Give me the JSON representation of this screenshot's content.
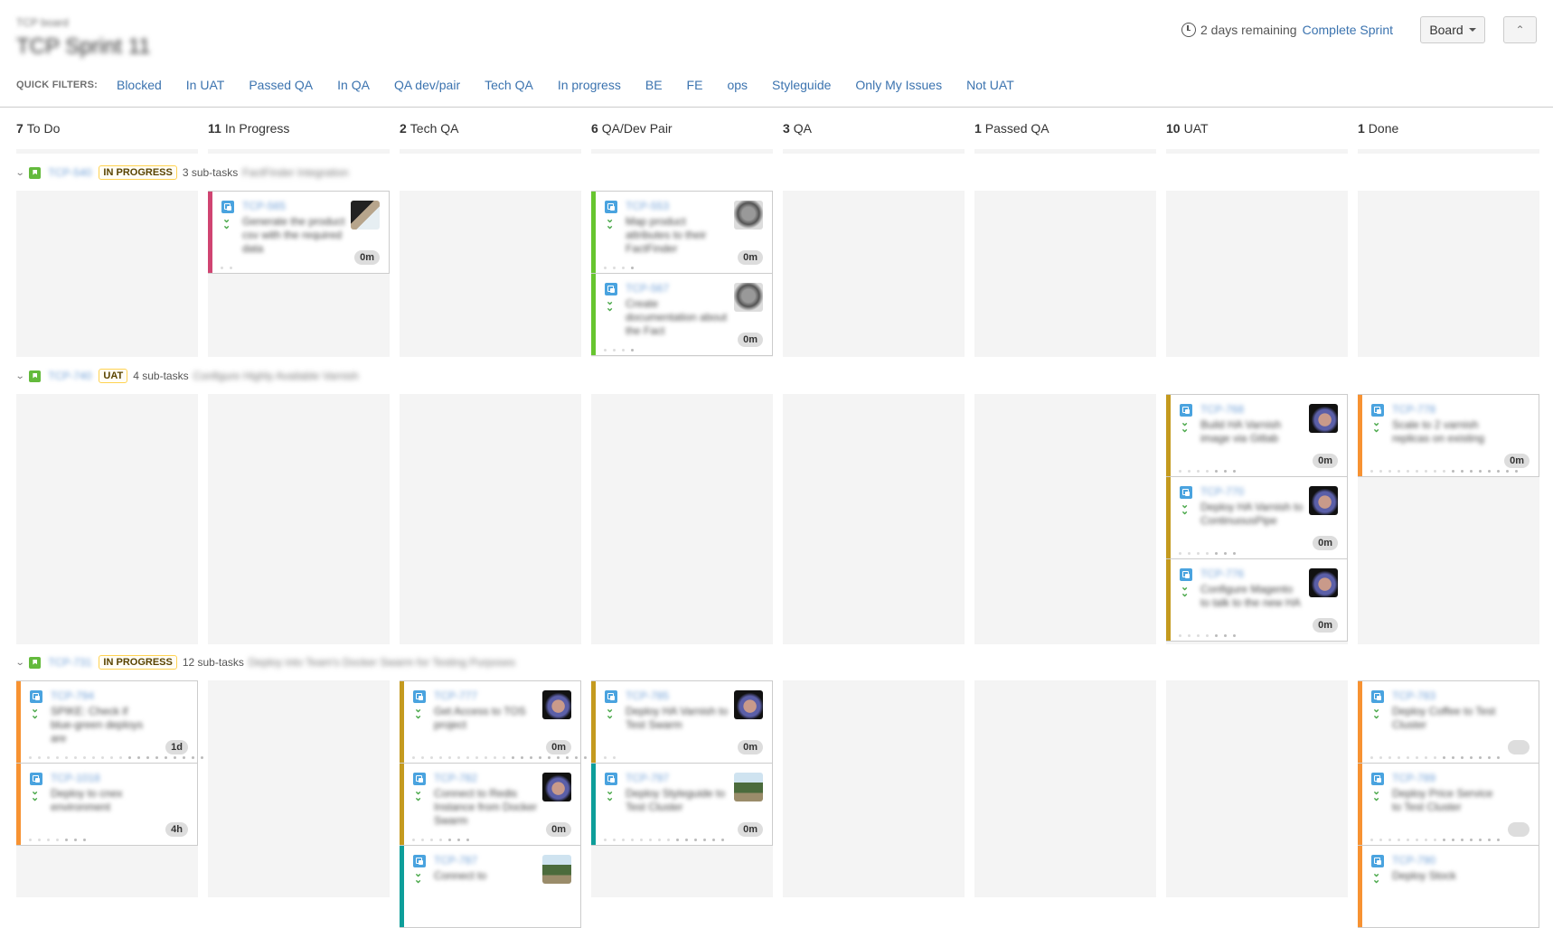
{
  "header": {
    "project_name": "TCP board",
    "sprint_name": "TCP Sprint 11",
    "time_remaining": "2 days remaining",
    "complete_sprint_label": "Complete Sprint",
    "board_button_label": "Board",
    "collapse_icon": "double-chevron-up-icon",
    "clock_icon": "clock-icon"
  },
  "quick_filters": {
    "label": "QUICK FILTERS:",
    "items": [
      "Blocked",
      "In UAT",
      "Passed QA",
      "In QA",
      "QA dev/pair",
      "Tech QA",
      "In progress",
      "BE",
      "FE",
      "ops",
      "Styleguide",
      "Only My Issues",
      "Not UAT"
    ]
  },
  "columns": [
    {
      "count": "7",
      "name": "To Do"
    },
    {
      "count": "11",
      "name": "In Progress"
    },
    {
      "count": "2",
      "name": "Tech QA"
    },
    {
      "count": "6",
      "name": "QA/Dev Pair"
    },
    {
      "count": "3",
      "name": "QA"
    },
    {
      "count": "1",
      "name": "Passed QA"
    },
    {
      "count": "10",
      "name": "UAT"
    },
    {
      "count": "1",
      "name": "Done"
    }
  ],
  "colors": {
    "link": "#3b73af",
    "story_green": "#63ba3c",
    "subtask_blue": "#4aa3df",
    "priority_green": "#4aa84a",
    "grab_pink": "#d04472",
    "grab_green": "#67c52f",
    "grab_gold": "#c49a1f",
    "grab_orange": "#f79232",
    "grab_teal": "#0d9e9a"
  },
  "swimlanes": [
    {
      "key": "TCP-540",
      "status": "IN PROGRESS",
      "subtasks": "3 sub-tasks",
      "summary": "FactFinder Integration",
      "cells": [
        [],
        [
          {
            "key": "TCP-565",
            "summary": "Generate the product csv with the required data",
            "estimate": "0m",
            "grab": "#d04472",
            "avatar": "av-c",
            "dots": 2
          }
        ],
        [],
        [
          {
            "key": "TCP-553",
            "summary": "Map product attributes to their FactFinder",
            "estimate": "0m",
            "grab": "#67c52f",
            "avatar": "av-b",
            "dots": 4
          },
          {
            "key": "TCP-567",
            "summary": "Create documentation about the Fact",
            "estimate": "0m",
            "grab": "#67c52f",
            "avatar": "av-b",
            "dots": 4
          }
        ],
        [],
        [],
        [],
        []
      ]
    },
    {
      "key": "TCP-740",
      "status": "UAT",
      "subtasks": "4 sub-tasks",
      "summary": "Configure Highly Available Varnish",
      "cells": [
        [],
        [],
        [],
        [],
        [],
        [],
        [
          {
            "key": "TCP-768",
            "summary": "Build HA Varnish image via Gitlab",
            "estimate": "0m",
            "grab": "#c49a1f",
            "avatar": "av-a",
            "dots": 7
          },
          {
            "key": "TCP-770",
            "summary": "Deploy HA Varnish to ContinuousPipe",
            "estimate": "0m",
            "grab": "#c49a1f",
            "avatar": "av-a",
            "dots": 7
          },
          {
            "key": "TCP-776",
            "summary": "Configure Magento to talk to the new HA",
            "estimate": "0m",
            "grab": "#c49a1f",
            "avatar": "av-a",
            "dots": 7
          }
        ],
        [
          {
            "key": "TCP-778",
            "summary": "Scale to 2 varnish replicas on existing",
            "estimate": "0m",
            "grab": "#f79232",
            "avatar": "",
            "dots": 17
          }
        ]
      ]
    },
    {
      "key": "TCP-731",
      "status": "IN PROGRESS",
      "subtasks": "12 sub-tasks",
      "summary": "Deploy into Team's Docker Swarm for Testing Purposes",
      "cells": [
        [
          {
            "key": "TCP-794",
            "summary": "SPIKE: Check if blue-green deploys are",
            "estimate": "1d",
            "grab": "#f79232",
            "avatar": "",
            "dots": 20
          },
          {
            "key": "TCP-1018",
            "summary": "Deploy to cnex environment",
            "estimate": "4h",
            "grab": "#f79232",
            "avatar": "",
            "dots": 7
          }
        ],
        [],
        [
          {
            "key": "TCP-777",
            "summary": "Get Access to TOS project",
            "estimate": "0m",
            "grab": "#c49a1f",
            "avatar": "av-a",
            "dots": 20
          },
          {
            "key": "TCP-782",
            "summary": "Connect to Redis Instance from Docker Swarm",
            "estimate": "0m",
            "grab": "#c49a1f",
            "avatar": "av-a",
            "dots": 7
          },
          {
            "key": "TCP-787",
            "summary": "Connect to",
            "estimate": "",
            "grab": "#0d9e9a",
            "avatar": "av-d",
            "dots": 0
          }
        ],
        [
          {
            "key": "TCP-785",
            "summary": "Deploy HA Varnish to Test Swarm",
            "estimate": "0m",
            "grab": "#c49a1f",
            "avatar": "av-a",
            "dots": 2
          },
          {
            "key": "TCP-797",
            "summary": "Deploy Styleguide to Test Cluster",
            "estimate": "0m",
            "grab": "#0d9e9a",
            "avatar": "av-d",
            "dots": 14
          }
        ],
        [],
        [],
        [],
        [
          {
            "key": "TCP-783",
            "summary": "Deploy Coffee to Test Cluster",
            "estimate": "",
            "grab": "#f79232",
            "avatar": "",
            "dots": 15
          },
          {
            "key": "TCP-789",
            "summary": "Deploy Price Service to Test Cluster",
            "estimate": "",
            "grab": "#f79232",
            "avatar": "",
            "dots": 15
          },
          {
            "key": "TCP-790",
            "summary": "Deploy Stock",
            "estimate": "",
            "grab": "#f79232",
            "avatar": "",
            "dots": 0
          }
        ]
      ]
    }
  ]
}
